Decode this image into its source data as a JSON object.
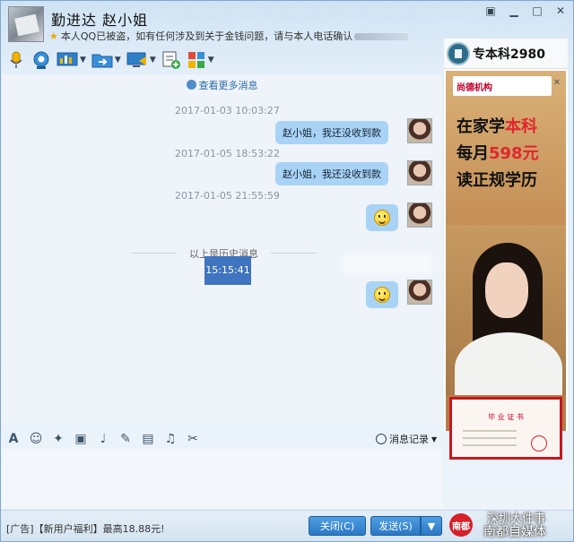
{
  "contact": {
    "name": "勤进达 赵小姐",
    "status": "本人QQ已被盗，如有任何涉及到关于金钱问题，请与本人电话确认"
  },
  "toolbar": {
    "items": [
      "mic-icon",
      "webcam-icon",
      "screen-share-icon",
      "file-transfer-icon",
      "remote-desktop-icon",
      "add-app-icon",
      "apps-grid-icon"
    ]
  },
  "chat": {
    "more_link": "查看更多消息",
    "messages": [
      {
        "time": "2017-01-03 10:03:27",
        "text": "赵小姐，我还没收到款"
      },
      {
        "time": "2017-01-05 18:53:22",
        "text": "赵小姐，我还没收到款"
      },
      {
        "time": "2017-01-05 21:55:59",
        "text": ""
      }
    ],
    "history_divider": "以上是历史消息",
    "selected_time": "15:15:41"
  },
  "ad": {
    "header": "专本科2980",
    "brand": "尚德机构",
    "line1_a": "在家学",
    "line1_b": "本科",
    "line2_a": "每月",
    "line2_b": "598元",
    "line3": "读正规学历",
    "cert_title": "毕 业 证 书"
  },
  "input": {
    "record_label": "消息记录"
  },
  "bottom": {
    "ad_text": "[广告]【新用户福利】最高18.88元!",
    "close_label": "关闭(C)",
    "send_label": "发送(S)"
  },
  "watermark": {
    "line1": "深圳大件事",
    "line2": "南都自媒体",
    "logo": "南都"
  },
  "colors": {
    "bubble": "#a9d3f5",
    "accent_red": "#e0262e",
    "button_blue": "#2b78c4"
  }
}
